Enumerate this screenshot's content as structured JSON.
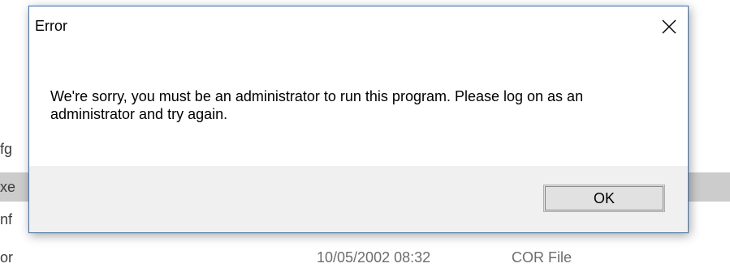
{
  "background_list": {
    "rows": [
      {
        "name": "fg",
        "date": "",
        "type": ""
      },
      {
        "name": "xe",
        "date": "",
        "type": ""
      },
      {
        "name": "nf",
        "date": "",
        "type": ""
      },
      {
        "name": "or",
        "date": "10/05/2002 08:32",
        "type": "COR File"
      }
    ]
  },
  "dialog": {
    "title": "Error",
    "message": "We're sorry, you must be an administrator to run this program.  Please log on as an administrator and try again.",
    "ok_label": "OK",
    "close_icon": "close-icon",
    "border_color": "#2f7cd1",
    "footer_color": "#f0f0f0"
  }
}
